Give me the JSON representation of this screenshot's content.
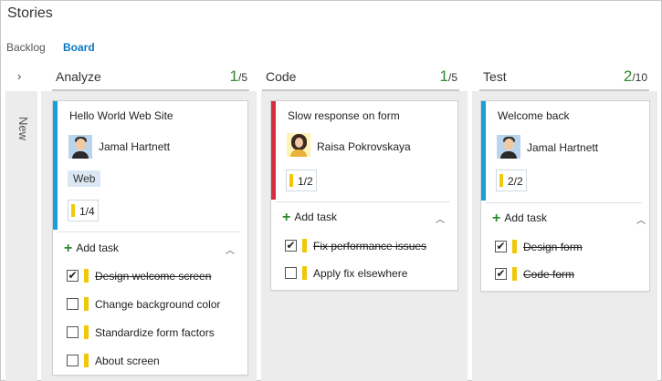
{
  "page": {
    "title": "Stories"
  },
  "tabs": [
    {
      "label": "Backlog"
    },
    {
      "label": "Board"
    }
  ],
  "side": {
    "expand_glyph": "›",
    "row_label": "New"
  },
  "columns": [
    {
      "name": "Analyze",
      "count": "1",
      "limit": "/5"
    },
    {
      "name": "Code",
      "count": "1",
      "limit": "/5"
    },
    {
      "name": "Test",
      "count": "2",
      "limit": "/10"
    }
  ],
  "cards": [
    {
      "title": "Hello World Web Site",
      "assignee": "Jamal Hartnett",
      "tag": "Web",
      "progress": "1/4",
      "bar_color": "#1aa0d8",
      "add_task": "Add task",
      "tasks": [
        {
          "label": "Design welcome screen",
          "done": true
        },
        {
          "label": "Change background color",
          "done": false
        },
        {
          "label": "Standardize form factors",
          "done": false
        },
        {
          "label": "About screen",
          "done": false
        }
      ]
    },
    {
      "title": "Slow response on form",
      "assignee": "Raisa Pokrovskaya",
      "progress": "1/2",
      "bar_color": "#d32f3f",
      "add_task": "Add task",
      "tasks": [
        {
          "label": "Fix performance issues",
          "done": true
        },
        {
          "label": "Apply fix elsewhere",
          "done": false
        }
      ]
    },
    {
      "title": "Welcome back",
      "assignee": "Jamal Hartnett",
      "progress": "2/2",
      "bar_color": "#1aa0d8",
      "add_task": "Add task",
      "tasks": [
        {
          "label": "Design form",
          "done": true
        },
        {
          "label": "Code form",
          "done": true
        }
      ]
    }
  ],
  "icons": {
    "check": "✔",
    "caret_up": "︿",
    "plus": "+"
  },
  "colors": {
    "accent": "#0a78c2",
    "count_green": "#2e8b2e",
    "task_yellow": "#f0c808"
  }
}
